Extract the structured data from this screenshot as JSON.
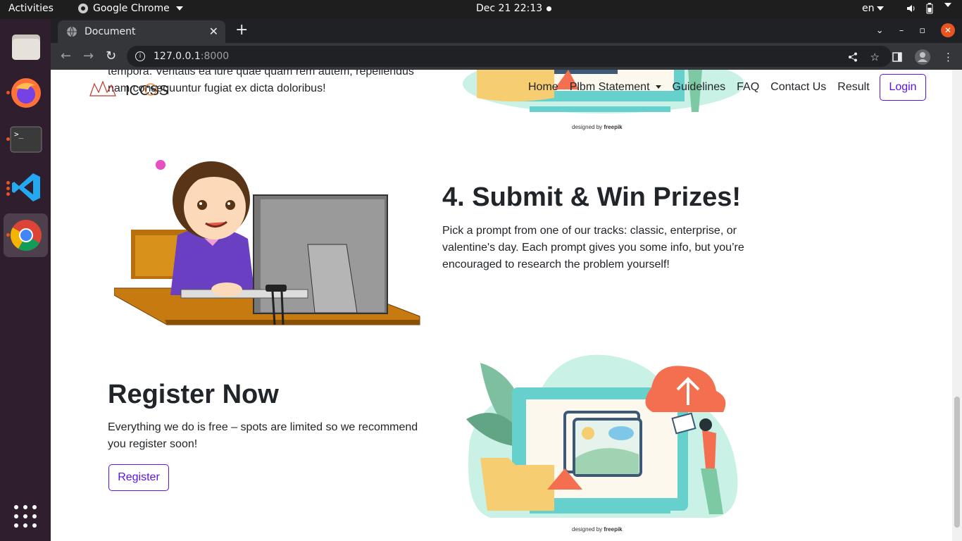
{
  "os": {
    "activities": "Activities",
    "app_name": "Google Chrome",
    "clock": "Dec 21  22:13",
    "lang": "en"
  },
  "browser": {
    "tab_title": "Document",
    "url_host": "127.0.0.1",
    "url_port": ":8000"
  },
  "nav": {
    "logo_text": "ICCSS",
    "items": [
      "Home",
      "Plbm Statement",
      "Guidelines",
      "FAQ",
      "Contact Us",
      "Result"
    ],
    "login": "Login"
  },
  "partial_section": {
    "line1": "tempora. Veritatis ea iure quae quam rem autem, repellendus",
    "line2": "nam consequuntur fugiat ex dicta doloribus!"
  },
  "step4": {
    "heading": "4. Submit & Win Prizes!",
    "body": "Pick a prompt from one of our tracks: classic, enterprise, or valentine's day. Each prompt gives you some info, but you’re encouraged to research the problem yourself!"
  },
  "register": {
    "heading": "Register Now",
    "body": "Everything we do is free – spots are limited so we recommend you register soon!",
    "button": "Register"
  },
  "credits": {
    "designed_by": "designed by",
    "brand": "freepik"
  },
  "colors": {
    "accent": "#5b13ec",
    "dock": "#2f1e2d",
    "ubuntu_orange": "#e95420"
  }
}
